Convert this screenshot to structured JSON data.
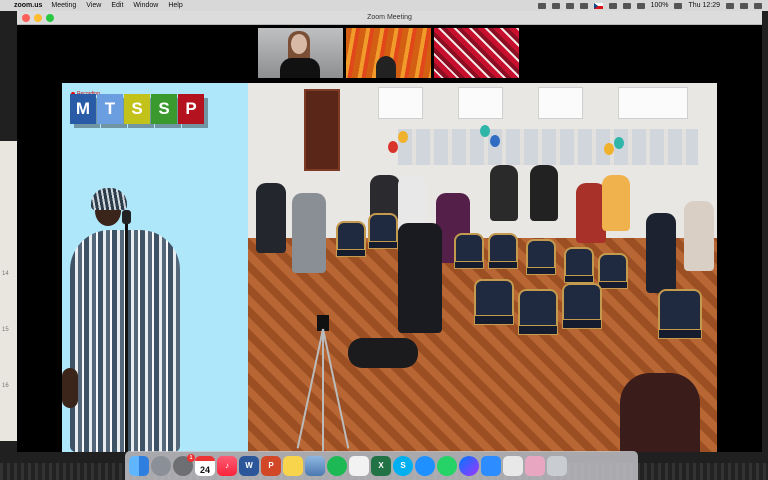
{
  "menubar": {
    "app_name": "zoom.us",
    "menus": [
      "Meeting",
      "View",
      "Edit",
      "Window",
      "Help"
    ],
    "battery": "100%",
    "clock": "Thu 12:29"
  },
  "window": {
    "title": "Zoom Meeting"
  },
  "video": {
    "recording_label": "Recording...",
    "logo_letters": [
      "M",
      "T",
      "S",
      "S",
      "P"
    ]
  },
  "desktop": {
    "side_numbers": [
      "14",
      "15",
      "16"
    ]
  },
  "dock": {
    "calendar_day": "24",
    "system_prefs_badge": "1",
    "apps": [
      "Finder",
      "Launchpad",
      "System Preferences",
      "Calendar",
      "Music",
      "Word",
      "PowerPoint",
      "Notes",
      "Preview",
      "Spotify",
      "Files",
      "Excel",
      "Skype",
      "Safari",
      "WhatsApp",
      "Messenger",
      "Zoom",
      "Photos",
      "Stickies",
      "Trash"
    ]
  },
  "colors": {
    "menubar": "#d8d8d8",
    "video_background": "#aee7fa",
    "record_red": "#e00000"
  }
}
